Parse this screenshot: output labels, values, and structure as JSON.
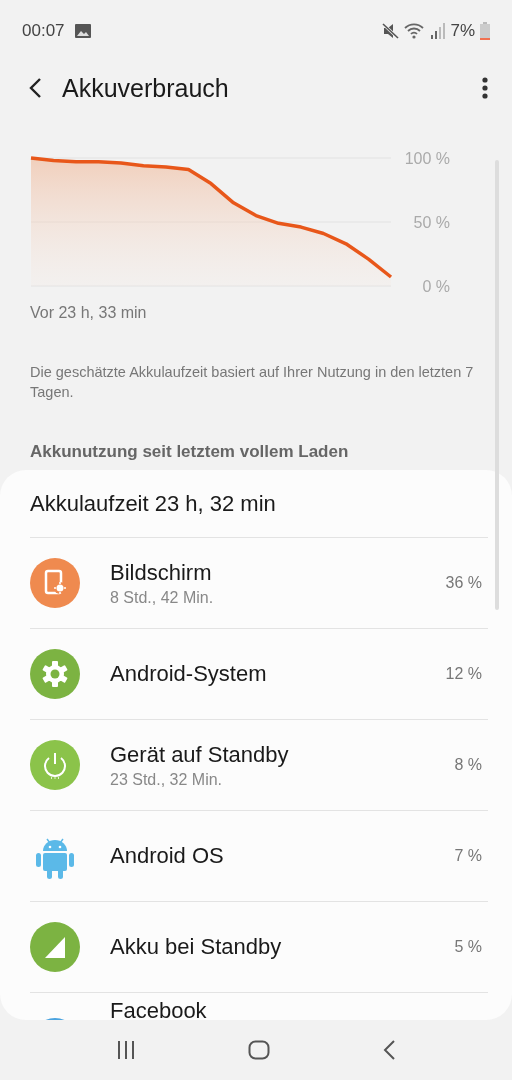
{
  "status_bar": {
    "time": "00:07",
    "battery": "7%"
  },
  "header": {
    "title": "Akkuverbrauch"
  },
  "chart": {
    "chart_data": {
      "type": "area",
      "values": [
        100,
        98,
        97,
        97,
        96,
        94,
        93,
        91,
        80,
        65,
        55,
        49,
        46,
        41,
        33,
        21,
        7
      ],
      "ylim": [
        0,
        100
      ],
      "yticks": [
        {
          "value": 100,
          "label": "100 %"
        },
        {
          "value": 50,
          "label": "50 %"
        },
        {
          "value": 0,
          "label": "0 %"
        }
      ]
    },
    "start_label": "Vor 23 h, 33 min"
  },
  "description": "Die geschätzte Akkulaufzeit basiert auf Ihrer Nutzung in den letzten 7 Tagen.",
  "section_title": "Akkunutzung seit letztem vollem Laden",
  "usage": {
    "title": "Akkulaufzeit 23 h, 32 min",
    "items": [
      {
        "name": "Bildschirm",
        "detail": "8 Std., 42 Min.",
        "percent": "36 %"
      },
      {
        "name": "Android-System",
        "percent": "12 %"
      },
      {
        "name": "Gerät auf Standby",
        "detail": "23 Std., 32 Min.",
        "percent": "8 %"
      },
      {
        "name": "Android OS",
        "percent": "7 %"
      },
      {
        "name": "Akku bei Standby",
        "percent": "5 %"
      },
      {
        "name": "Facebook"
      }
    ]
  }
}
